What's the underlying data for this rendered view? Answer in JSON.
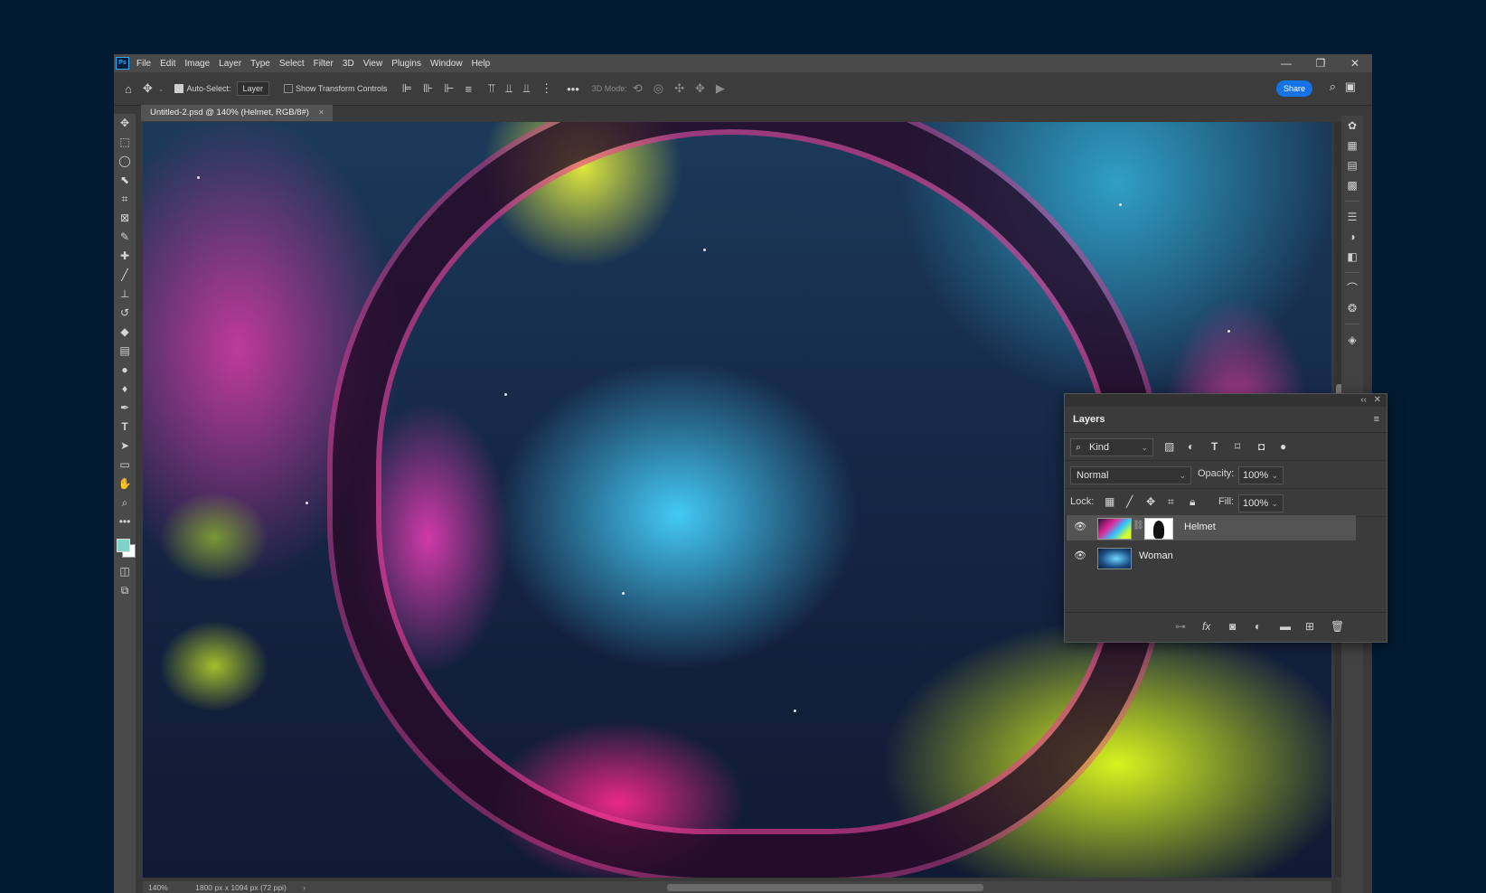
{
  "app": {
    "logo_text": "Ps",
    "menu": [
      "File",
      "Edit",
      "Image",
      "Layer",
      "Type",
      "Select",
      "Filter",
      "3D",
      "View",
      "Plugins",
      "Window",
      "Help"
    ],
    "window_controls": {
      "minimize": "—",
      "restore": "❐",
      "close": "✕"
    }
  },
  "options_bar": {
    "auto_select_label": "Auto-Select:",
    "auto_select_value": "Layer",
    "show_transform_label": "Show Transform Controls",
    "mode_label": "3D Mode:",
    "share_label": "Share"
  },
  "document": {
    "tab_title": "Untitled-2.psd @ 140% (Helmet, RGB/8#)",
    "tab_close": "×"
  },
  "status_bar": {
    "zoom": "140%",
    "doc_info": "1800 px x 1094 px (72 ppi)",
    "arrow": "›"
  },
  "layers_panel": {
    "title": "Layers",
    "filter_kind": "Kind",
    "blend_mode": "Normal",
    "opacity_label": "Opacity:",
    "opacity_value": "100%",
    "lock_label": "Lock:",
    "fill_label": "Fill:",
    "fill_value": "100%",
    "layers": [
      {
        "name": "Helmet",
        "visible": true,
        "selected": true,
        "has_mask": true
      },
      {
        "name": "Woman",
        "visible": true,
        "selected": false,
        "has_mask": false
      }
    ],
    "footer_icons": [
      "link-layers-icon",
      "fx-icon",
      "add-mask-icon",
      "adjustment-icon",
      "folder-icon",
      "new-layer-icon",
      "trash-icon"
    ]
  },
  "colors": {
    "background": "#021b33",
    "accent": "#1473e6",
    "foreground_swatch": "#7fd4c8",
    "background_swatch": "#ffffff"
  }
}
